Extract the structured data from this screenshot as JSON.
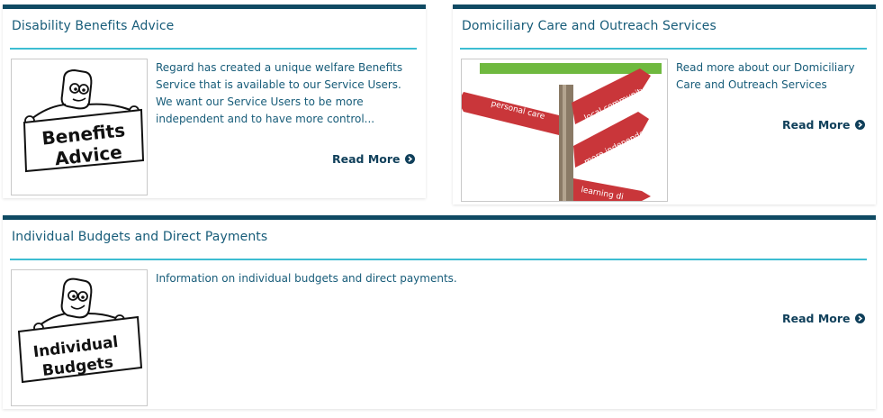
{
  "cards": [
    {
      "title": "Disability Benefits Advice",
      "image_alt": "Benefits Advice cartoon",
      "image_words": [
        "Benefits",
        "Advice"
      ],
      "description": "Regard has created a unique welfare Benefits Service that is available to our Service Users. We want our Service Users to be more independent and to have more control...",
      "read_more": "Read More"
    },
    {
      "title": "Domiciliary Care and Outreach Services",
      "image_alt": "Signpost photo",
      "image_words": [
        "local community",
        "personal care",
        "more independent",
        "learning di"
      ],
      "description": "Read more about our Domiciliary Care and Outreach Services",
      "read_more": "Read More"
    },
    {
      "title": "Individual Budgets and Direct Payments",
      "image_alt": "Individual Budgets cartoon",
      "image_words": [
        "Individual",
        "Budgets"
      ],
      "description": "Information on individual budgets and direct payments.",
      "read_more": "Read More"
    }
  ],
  "colors": {
    "card_top_border": "#0f4a63",
    "title_rule": "#3dbdd2",
    "text": "#175c79",
    "link": "#0f3f5a",
    "sign_red": "#c9363a",
    "sign_green": "#6fb93f"
  }
}
